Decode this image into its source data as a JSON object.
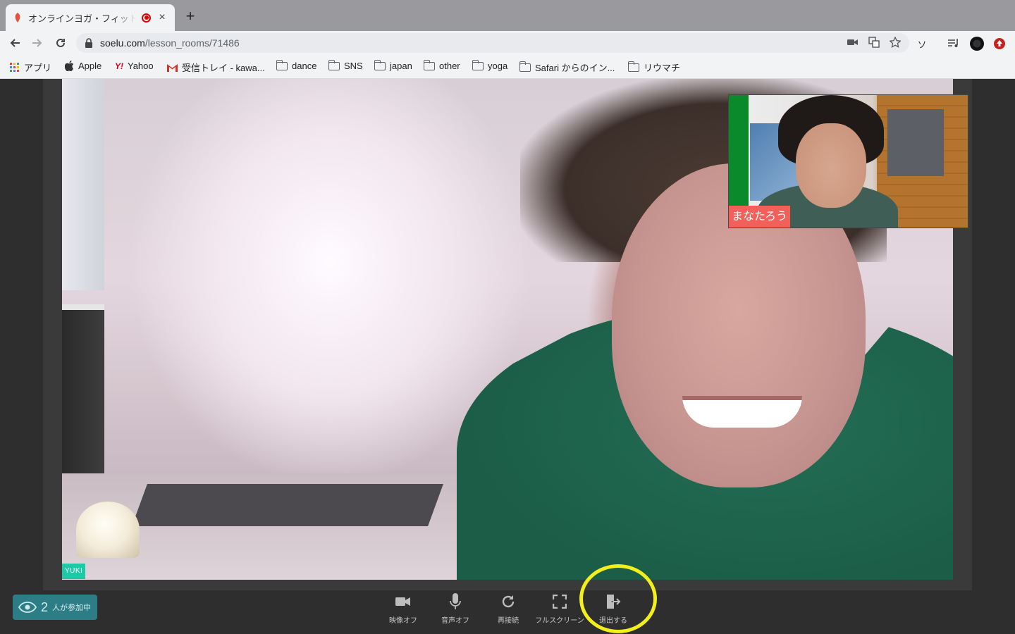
{
  "browser": {
    "tab_title": "オンラインヨガ・フィットネ",
    "new_tab_symbol": "+",
    "close_symbol": "×",
    "url_host": "soelu.com",
    "url_path": "/lesson_rooms/71486",
    "profile_letter": "ソ"
  },
  "bookmarks": [
    {
      "label": "アプリ",
      "icon": "apps-grid-icon"
    },
    {
      "label": "Apple",
      "icon": "apple-icon"
    },
    {
      "label": "Yahoo",
      "icon": "yahoo-icon"
    },
    {
      "label": "受信トレイ - kawa...",
      "icon": "gmail-icon"
    },
    {
      "label": "dance",
      "icon": "folder-icon"
    },
    {
      "label": "SNS",
      "icon": "folder-icon"
    },
    {
      "label": "japan",
      "icon": "folder-icon"
    },
    {
      "label": "other",
      "icon": "folder-icon"
    },
    {
      "label": "yoga",
      "icon": "folder-icon"
    },
    {
      "label": "Safari からのイン...",
      "icon": "folder-icon"
    },
    {
      "label": "リウマチ",
      "icon": "folder-icon"
    }
  ],
  "video": {
    "main_participant": "YUKI",
    "pip_participant": "まなたろう"
  },
  "bottom_bar": {
    "participant_count": "2",
    "participant_label": "人が参加中",
    "controls": [
      {
        "label": "映像オフ",
        "icon": "video-camera-icon"
      },
      {
        "label": "音声オフ",
        "icon": "microphone-icon"
      },
      {
        "label": "再接続",
        "icon": "refresh-icon"
      },
      {
        "label": "フルスクリーン",
        "icon": "fullscreen-icon"
      },
      {
        "label": "退出する",
        "icon": "exit-door-icon"
      }
    ]
  },
  "colors": {
    "accent_teal": "#2c7d86",
    "name_tag_green": "#1ec9a6",
    "name_tag_red": "#f1615a",
    "highlight_yellow": "#f2ef1a"
  }
}
